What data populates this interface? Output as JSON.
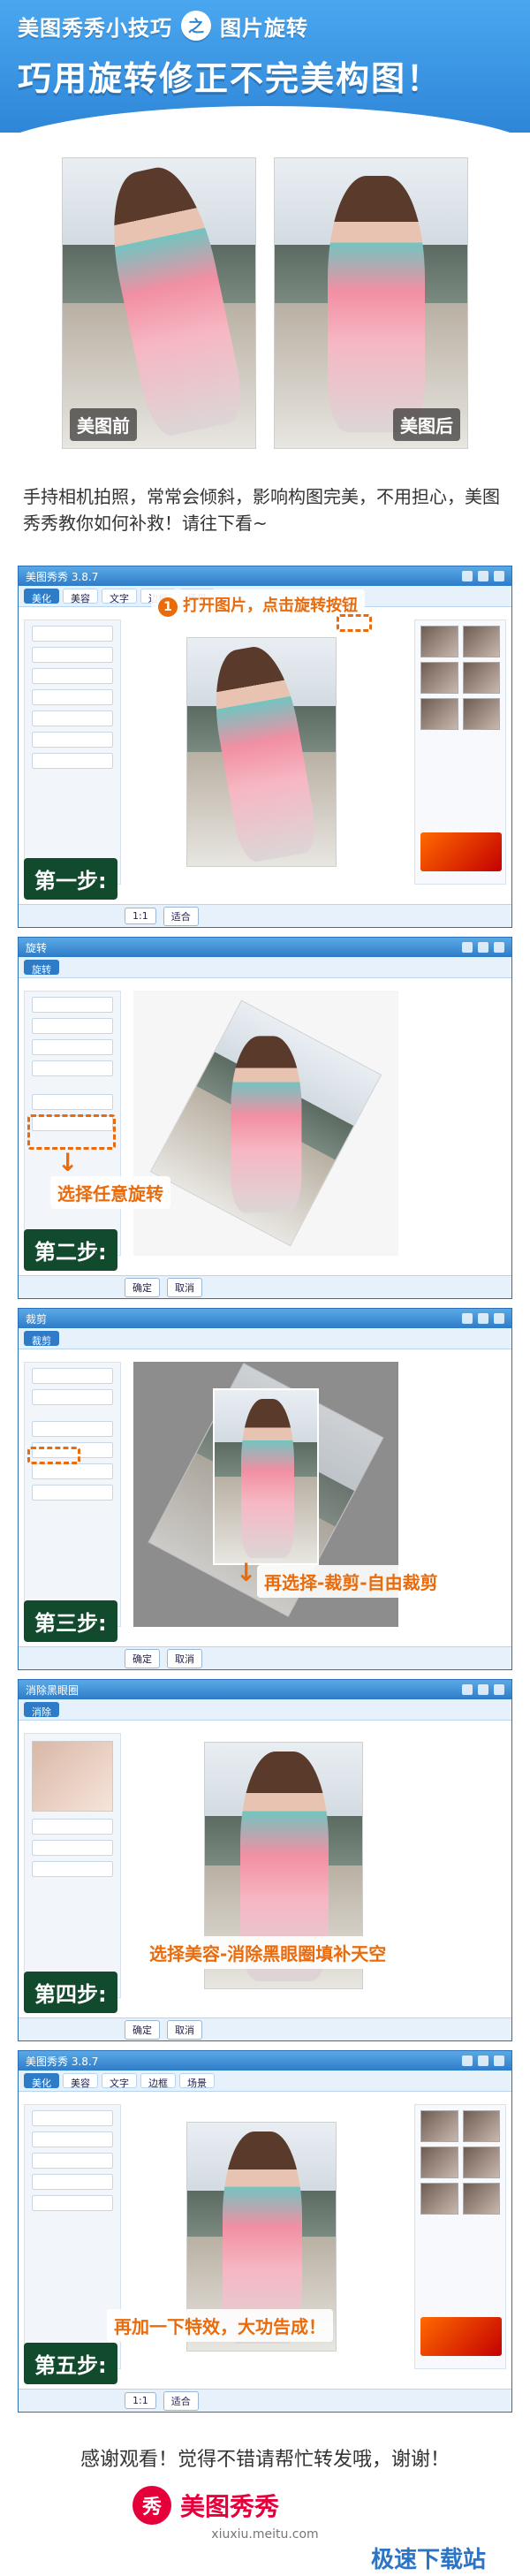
{
  "header": {
    "app_name": "美图秀秀小技巧",
    "joiner": "之",
    "topic": "图片旋转",
    "headline": "巧用旋转修正不完美构图！"
  },
  "comparison": {
    "before_label": "美图前",
    "after_label": "美图后"
  },
  "intro": "手持相机拍照，常常会倾斜，影响构图完美，不用担心，美图秀秀教你如何补救！请往下看~",
  "steps": [
    {
      "label": "第一步:",
      "window_title": "美图秀秀 3.8.7",
      "callout_num": "1",
      "callout": "打开图片，点击旋转按钮"
    },
    {
      "label": "第二步:",
      "window_title": "旋转",
      "callout": "选择任意旋转",
      "tab_label": "旋转"
    },
    {
      "label": "第三步:",
      "window_title": "裁剪",
      "callout": "再选择-裁剪-自由裁剪",
      "tab_label": "裁剪"
    },
    {
      "label": "第四步:",
      "window_title": "消除黑眼圈",
      "callout": "选择美容-消除黑眼圈填补天空"
    },
    {
      "label": "第五步:",
      "window_title": "美图秀秀 3.8.7",
      "callout": "再加一下特效，大功告成！"
    }
  ],
  "footer": {
    "thanks": "感谢观看！觉得不错请帮忙转发哦，谢谢！",
    "logo_char": "秀",
    "logo_text": "美图秀秀",
    "logo_url": "xiuxiu.meitu.com",
    "brand": "极速下载站"
  },
  "colors": {
    "header_blue": "#2f86d8",
    "accent_orange": "#e96b0c",
    "step_green": "#114a2c",
    "logo_red": "#e6003a"
  }
}
